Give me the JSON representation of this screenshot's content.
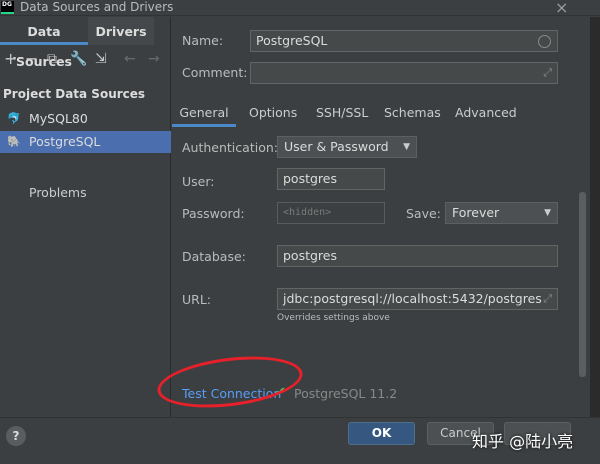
{
  "window": {
    "title": "Data Sources and Drivers",
    "app_icon_label": "DG",
    "close_glyph": "×"
  },
  "left": {
    "tabs": [
      {
        "label": "Data Sources"
      },
      {
        "label": "Drivers"
      }
    ],
    "toolbar_icons": [
      "plus-icon",
      "minus-icon",
      "duplicate-icon",
      "wrench-icon",
      "import-icon",
      "back-arrow-icon",
      "forward-arrow-icon"
    ],
    "section_title": "Project Data Sources",
    "items": [
      {
        "label": "MySQL80",
        "icon": "mysql-icon"
      },
      {
        "label": "PostgreSQL",
        "icon": "postgresql-icon"
      }
    ],
    "problems_label": "Problems"
  },
  "form": {
    "name_label": "Name:",
    "name_value": "PostgreSQL",
    "comment_label": "Comment:",
    "comment_value": "",
    "tabs": [
      "General",
      "Options",
      "SSH/SSL",
      "Schemas",
      "Advanced"
    ],
    "auth_label": "Authentication:",
    "auth_value": "User & Password",
    "user_label": "User:",
    "user_value": "postgres",
    "password_label": "Password:",
    "password_placeholder": "<hidden>",
    "save_label": "Save:",
    "save_value": "Forever",
    "database_label": "Database:",
    "database_value": "postgres",
    "url_label": "URL:",
    "url_value": "jdbc:postgresql://localhost:5432/postgres",
    "url_hint": "Overrides settings above",
    "test_connection": "Test Connection",
    "test_status_glyph": "✔",
    "server_version": "PostgreSQL 11.2"
  },
  "buttons": {
    "help": "?",
    "ok": "OK",
    "cancel": "Cancel"
  },
  "watermark": "知乎 @陆小亮",
  "colors": {
    "accent": "#4a88c7",
    "selection": "#4b6eaf",
    "link": "#589df6",
    "success": "#5fb85f",
    "annotation": "#e8202a"
  }
}
